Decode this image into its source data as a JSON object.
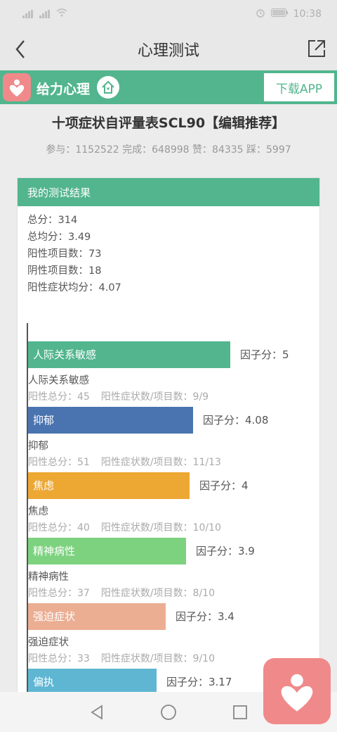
{
  "statusbar": {
    "time": "10:38"
  },
  "titlebar": {
    "title": "心理测试"
  },
  "brand": {
    "name": "给力心理",
    "download_label": "下载APP"
  },
  "test": {
    "title": "十项症状自评量表SCL90【编辑推荐】",
    "stats": "参与：1152522 完成：648998 赞：84335 踩：5997"
  },
  "result": {
    "header": "我的测试结果",
    "summary": [
      "总分：314",
      "总均分：3.49",
      "阳性项目数：73",
      "阴性项目数：18",
      "阳性症状均分：4.07"
    ]
  },
  "colors": {
    "accent": "#52b58e",
    "brand_pink": "#f08a8a"
  },
  "chart_data": {
    "type": "bar",
    "orientation": "horizontal",
    "score_label": "因子分：",
    "factors": [
      {
        "label": "人际关系敏感",
        "value": 5,
        "value_text": "5",
        "color": "#52b58e",
        "detail_total": "阳性总分：45",
        "detail_count": "阳性症状数/项目数：9/9"
      },
      {
        "label": "抑郁",
        "value": 4.08,
        "value_text": "4.08",
        "color": "#4a74b0",
        "detail_total": "阳性总分：51",
        "detail_count": "阳性症状数/项目数：11/13"
      },
      {
        "label": "焦虑",
        "value": 4,
        "value_text": "4",
        "color": "#eda733",
        "detail_total": "阳性总分：40",
        "detail_count": "阳性症状数/项目数：10/10"
      },
      {
        "label": "精神病性",
        "value": 3.9,
        "value_text": "3.9",
        "color": "#7cd27e",
        "detail_total": "阳性总分：37",
        "detail_count": "阳性症状数/项目数：8/10"
      },
      {
        "label": "强迫症状",
        "value": 3.4,
        "value_text": "3.4",
        "color": "#ebae93",
        "detail_total": "阳性总分：33",
        "detail_count": "阳性症状数/项目数：9/10"
      },
      {
        "label": "偏执",
        "value": 3.17,
        "value_text": "3.17",
        "color": "#5eb6d2",
        "detail_total": "",
        "detail_count": ""
      }
    ]
  }
}
